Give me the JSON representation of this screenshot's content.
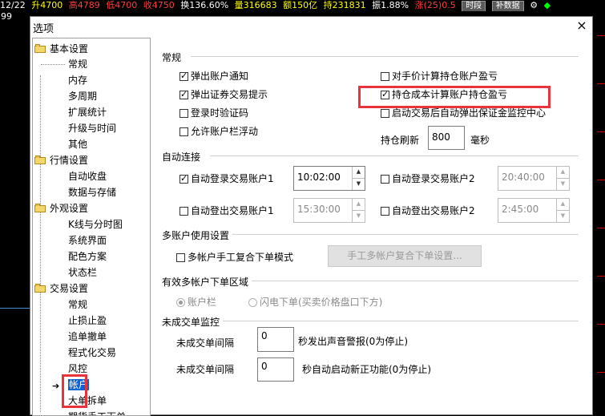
{
  "ticker": {
    "time": "12/22",
    "up": "升4700",
    "high": "高4789",
    "low": "低4700",
    "close": "收4750",
    "turnover_rate": "换136.60%",
    "volume": "量316683",
    "amount": "额150亿",
    "hold": "持231831",
    "amplitude": "振1.88%",
    "change": "涨(25)0.5",
    "btn_time": "时段",
    "btn_supplement": "补数据",
    "left_value": "99"
  },
  "dialog": {
    "title": "选项",
    "close": "×"
  },
  "tree": {
    "groups": [
      {
        "label": "基本设置",
        "items": [
          "常规",
          "内存",
          "多周期",
          "扩展统计",
          "升级与时间",
          "其他"
        ]
      },
      {
        "label": "行情设置",
        "items": [
          "自动收盘",
          "数据与存储"
        ]
      },
      {
        "label": "外观设置",
        "items": [
          "K线与分时图",
          "系统界面",
          "配色方案",
          "状态栏"
        ]
      },
      {
        "label": "交易设置",
        "items": [
          "常规",
          "止损止盈",
          "追单撤单",
          "程式化交易",
          "风控",
          "帐户",
          "大单拆单",
          "期货手工下单"
        ]
      }
    ]
  },
  "general": {
    "title": "常规",
    "popup_account_notice": "弹出账户通知",
    "popup_trade_tip": "弹出证券交易提示",
    "login_captcha": "登录时验证码",
    "allow_float": "允许账户栏浮动",
    "manual_price_pnl": "对手价计算持仓账户盈亏",
    "cost_price_pnl": "持仓成本计算账户持仓盈亏",
    "auto_popup_margin": "启动交易后自动弹出保证金监控中心",
    "refresh_label": "持仓刷新",
    "refresh_value": "800",
    "refresh_unit": "毫秒"
  },
  "auto_connect": {
    "title": "自动连接",
    "login1": "自动登录交易账户1",
    "login1_time": "10:02:00",
    "login2": "自动登录交易账户2",
    "login2_time": "20:40:00",
    "logout1": "自动登出交易账户1",
    "logout1_time": "15:30:00",
    "logout2": "自动登出交易账户2",
    "logout2_time": "2:45:00"
  },
  "multi": {
    "title": "多账户使用设置",
    "manual_mode": "多帐户手工复合下单模式",
    "settings_btn": "手工多帐户复合下单设置..."
  },
  "region": {
    "title": "有效多帐户下单区域",
    "opt_bar": "账户栏",
    "opt_flash": "闪电下单(买卖价格盘口下方)"
  },
  "unfilled": {
    "title": "未成交单监控",
    "interval1_label": "未成交单间隔",
    "interval1_value": "0",
    "interval1_desc": "秒发出声音警报(0为停止)",
    "interval2_label": "未成交单间隔",
    "interval2_value": "0",
    "interval2_desc": "秒自动启动新正功能(0为停止)"
  }
}
